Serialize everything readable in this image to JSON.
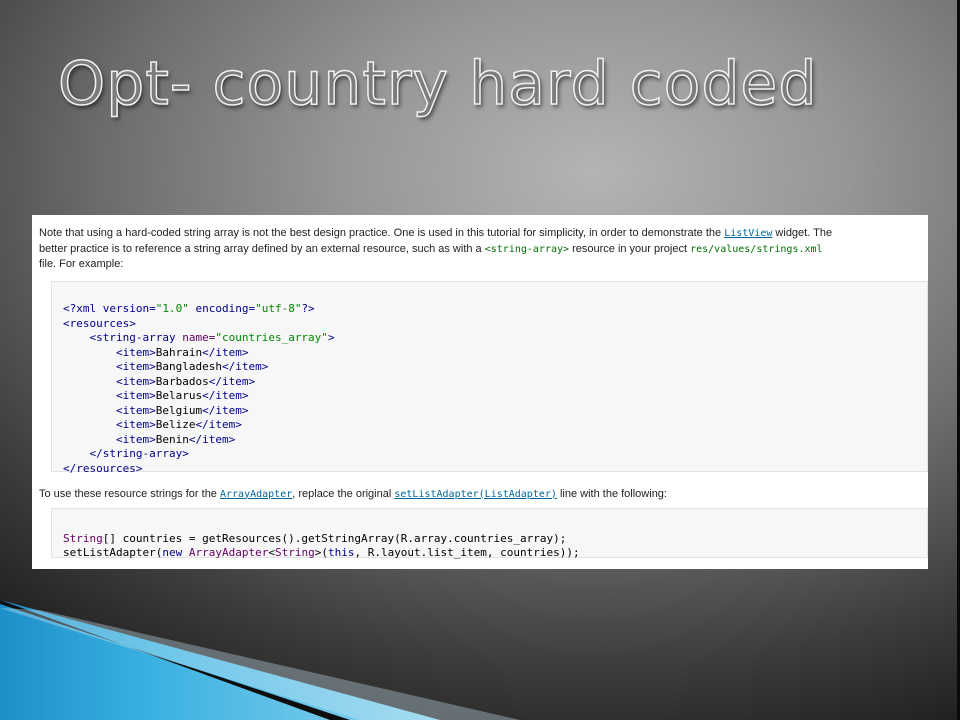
{
  "slide": {
    "title": "Opt- country hard coded"
  },
  "screenshot": {
    "para1": {
      "t1": "Note that using a hard-coded string array is not the best design practice. One is used in this tutorial for simplicity, in order to demonstrate the ",
      "link_listview": "ListView",
      "t2": " widget. The",
      "t3": "better practice is to reference a string array defined by an external resource, such as with a ",
      "code_string_array": "<string-array>",
      "t4": " resource in your project ",
      "code_path": "res/values/strings.xml",
      "t5": "file. For example:"
    },
    "xml": {
      "decl_open": "<?xml version=",
      "decl_version": "\"1.0\"",
      "decl_mid": " encoding=",
      "decl_encoding": "\"utf-8\"",
      "decl_close": "?>",
      "resources_open": "<resources>",
      "sa_open": "<string-array",
      "sa_attr": " name=",
      "sa_val": "\"countries_array\"",
      "sa_close": ">",
      "item_open": "<item>",
      "item_close": "</item>",
      "items": [
        "Bahrain",
        "Bangladesh",
        "Barbados",
        "Belarus",
        "Belgium",
        "Belize",
        "Benin"
      ],
      "sa_end": "</string-array>",
      "resources_end": "</resources>"
    },
    "para2": {
      "t1": "To use these resource strings for the ",
      "link_arrayadapter": "ArrayAdapter",
      "t2": ", replace the original ",
      "link_setlistadapter": "setListAdapter(ListAdapter)",
      "t3": " line with the following:"
    },
    "java": {
      "l1_type": "String",
      "l1_rest": "[] countries = getResources().getStringArray(R.array.countries_array);",
      "l2_a": "setListAdapter(",
      "l2_new": "new",
      "l2_b": " ",
      "l2_type1": "ArrayAdapter",
      "l2_lt": "<",
      "l2_type2": "String",
      "l2_gt": ">",
      "l2_c": "(",
      "l2_this": "this",
      "l2_d": ", R.layout.list_item, countries));"
    }
  },
  "colors": {
    "tag": "#000088",
    "attr": "#660066",
    "string": "#008800",
    "link": "#006699",
    "inline_code": "#007000",
    "decor_blue": "#29a3d6"
  },
  "icons": [
    "slide-corner-decoration"
  ]
}
